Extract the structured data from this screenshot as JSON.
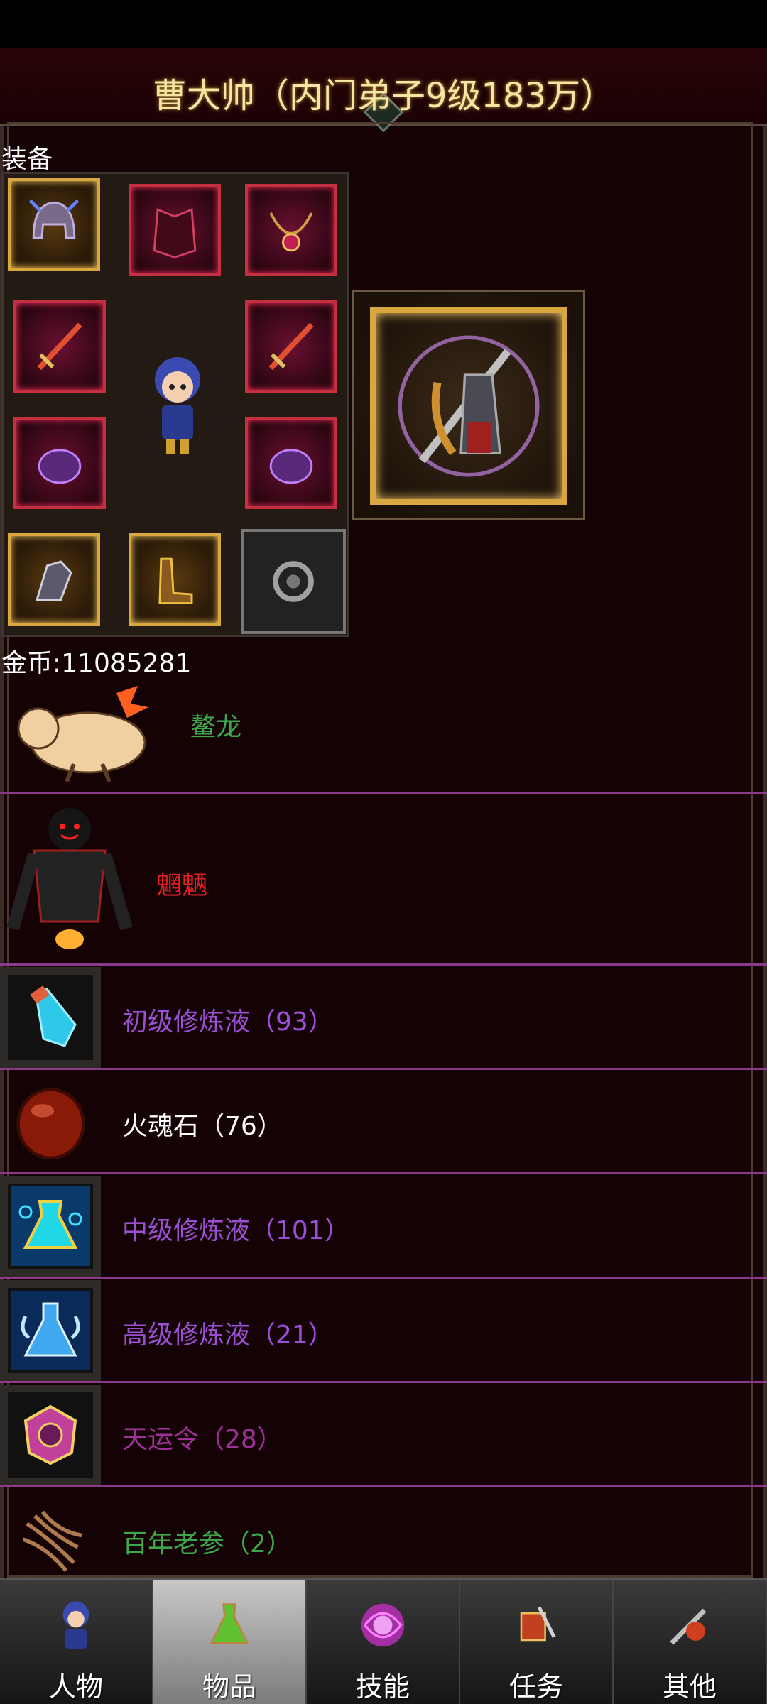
{
  "header": {
    "title": "曹大帅（内门弟子9级183万）"
  },
  "equipment": {
    "section_label": "装备",
    "slots": [
      {
        "icon": "helmet-icon"
      },
      {
        "icon": "armor-icon"
      },
      {
        "icon": "necklace-icon"
      },
      {
        "icon": "sword-left-icon"
      },
      {
        "icon": "sword-right-icon"
      },
      {
        "icon": "bracer-left-icon"
      },
      {
        "icon": "bracer-right-icon"
      },
      {
        "icon": "gauntlet-icon"
      },
      {
        "icon": "boots-icon"
      },
      {
        "icon": "ring-icon"
      }
    ],
    "featured_icon": "warrior-weapon-icon"
  },
  "gold": {
    "label": "金币:11085281"
  },
  "pets": [
    {
      "name": "鳌龙",
      "color": "#3fa64a",
      "icon": "dragon-pet-icon"
    },
    {
      "name": "魍魉",
      "color": "#e02020",
      "icon": "demon-pet-icon"
    }
  ],
  "items": [
    {
      "label": "初级修炼液（93）",
      "color": "#9b4fd6",
      "icon": "vial-blue-icon"
    },
    {
      "label": "火魂石（76）",
      "color": "#ffffff",
      "icon": "fire-stone-icon"
    },
    {
      "label": "中级修炼液（101）",
      "color": "#9b4fd6",
      "icon": "flask-cyan-icon"
    },
    {
      "label": "高级修炼液（21）",
      "color": "#9b4fd6",
      "icon": "flask-winged-icon"
    },
    {
      "label": "天运令（28）",
      "color": "#a0309c",
      "icon": "token-icon"
    },
    {
      "label": "百年老参（2）",
      "color": "#3fa64a",
      "icon": "ginseng-icon"
    }
  ],
  "nav": {
    "tabs": [
      {
        "label": "人物",
        "icon": "character-icon",
        "active": false
      },
      {
        "label": "物品",
        "icon": "potion-icon",
        "active": true
      },
      {
        "label": "技能",
        "icon": "skill-orb-icon",
        "active": false
      },
      {
        "label": "任务",
        "icon": "quest-icon",
        "active": false
      },
      {
        "label": "其他",
        "icon": "other-icon",
        "active": false
      }
    ]
  },
  "colors": {
    "background": "#140205",
    "title": "#f5e6a3",
    "divider": "#8a3a8a",
    "slot_red": "#c43040",
    "slot_gold": "#d9a640"
  }
}
